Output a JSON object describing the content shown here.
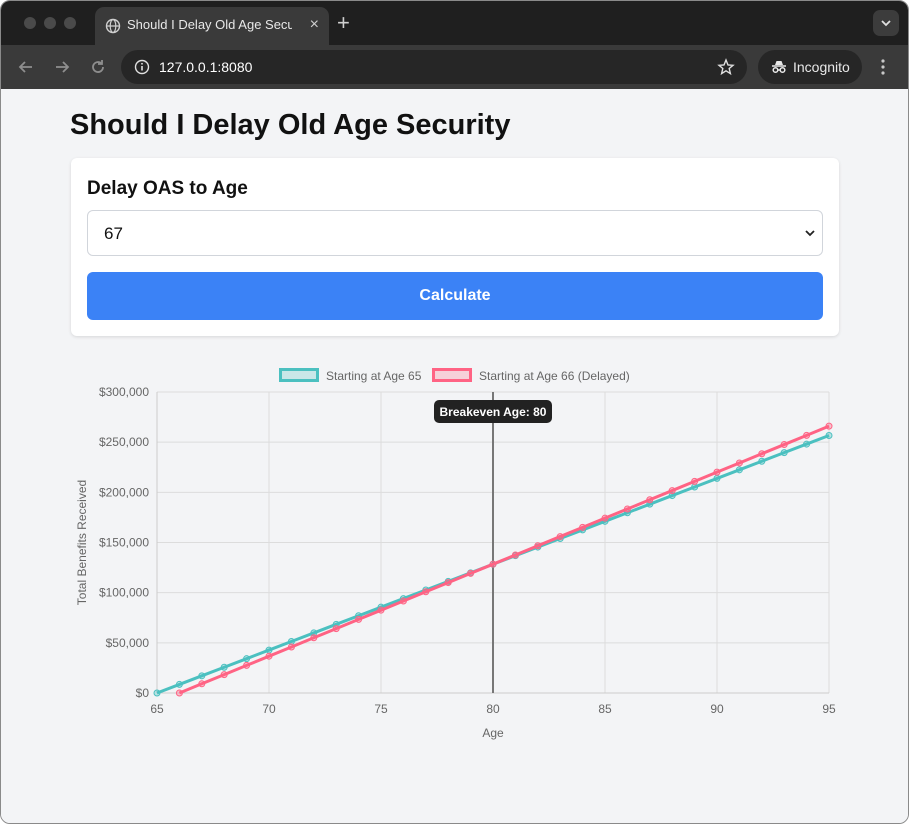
{
  "browser": {
    "tab_title": "Should I Delay Old Age Security",
    "tab_close": "×",
    "new_tab": "+",
    "url": "127.0.0.1:8080",
    "incognito_label": "Incognito"
  },
  "page": {
    "title": "Should I Delay Old Age Security",
    "form": {
      "label": "Delay OAS to Age",
      "selected_age": "67",
      "calculate_label": "Calculate"
    }
  },
  "chart_data": {
    "type": "line",
    "x": [
      65,
      66,
      67,
      68,
      69,
      70,
      71,
      72,
      73,
      74,
      75,
      76,
      77,
      78,
      79,
      80,
      81,
      82,
      83,
      84,
      85,
      86,
      87,
      88,
      89,
      90,
      91,
      92,
      93,
      94,
      95
    ],
    "series": [
      {
        "name": "Starting at Age 65",
        "color": "#4bc0c0",
        "start_age": 65,
        "values": [
          0,
          8555,
          17110,
          25665,
          34220,
          42775,
          51330,
          59885,
          68440,
          76995,
          85550,
          94105,
          102660,
          111215,
          119770,
          128325,
          136880,
          145435,
          153990,
          162545,
          171100,
          179655,
          188210,
          196765,
          205320,
          213875,
          222430,
          230985,
          239540,
          248095,
          256650
        ]
      },
      {
        "name": "Starting at Age 66 (Delayed)",
        "color": "#ff6384",
        "start_age": 66,
        "values": [
          null,
          0,
          9171,
          18342,
          27513,
          36684,
          45855,
          55026,
          64197,
          73368,
          82539,
          91710,
          100881,
          110052,
          119223,
          128394,
          137565,
          146736,
          155907,
          165078,
          174249,
          183420,
          192591,
          201762,
          210933,
          220104,
          229275,
          238446,
          247617,
          256788,
          265959
        ]
      }
    ],
    "xlabel": "Age",
    "ylabel": "Total Benefits Received",
    "xlim": [
      65,
      95
    ],
    "ylim": [
      0,
      300000
    ],
    "x_ticks": [
      "65",
      "70",
      "75",
      "80",
      "85",
      "90",
      "95"
    ],
    "y_ticks": [
      "$0",
      "$50,000",
      "$100,000",
      "$150,000",
      "$200,000",
      "$250,000",
      "$300,000"
    ],
    "breakeven_age": 80,
    "annotation": "Breakeven Age: 80",
    "grid": true,
    "legend": "top"
  }
}
